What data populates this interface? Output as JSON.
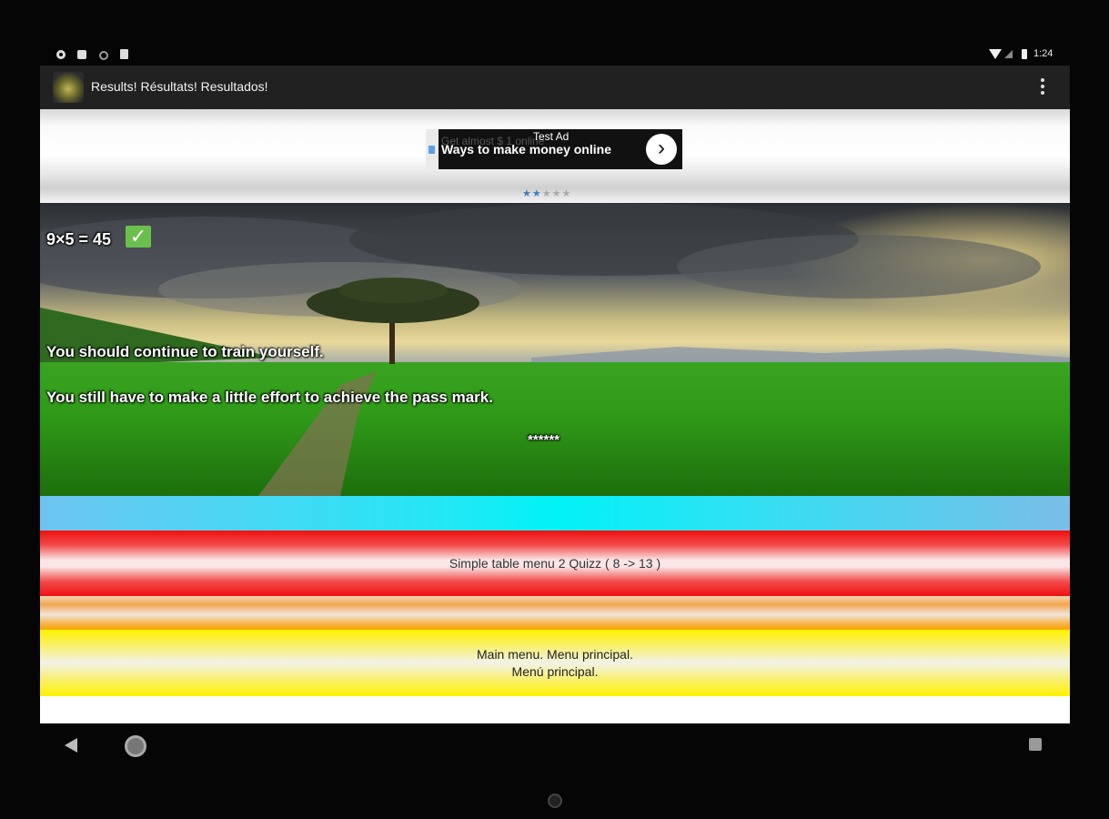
{
  "status_bar": {
    "time": "1:24"
  },
  "action_bar": {
    "title": "Results! Résultats! Resultados!"
  },
  "ad": {
    "label": "Test Ad",
    "headline": "Ways to make money online",
    "ghost_text": "Get almost $ 1 online",
    "rating": {
      "filled": 2,
      "total": 5
    }
  },
  "result": {
    "question": "9×5 = 45",
    "status_icon": "check-icon",
    "message_1": "You should continue to train yourself.",
    "message_2": "You still have to make a little effort to achieve the pass mark.",
    "asterisks": "******"
  },
  "menu": {
    "quiz_button": "Simple table menu 2 Quizz ( 8 -> 13 )",
    "main_menu_line1": "Main menu. Menu principal.",
    "main_menu_line2": "Menú principal."
  },
  "colors": {
    "action_bar": "#212121",
    "cyan_band": "#00f2f6",
    "red_band": "#f01010",
    "orange_band": "#f7a400",
    "yellow_band": "#fff200"
  }
}
